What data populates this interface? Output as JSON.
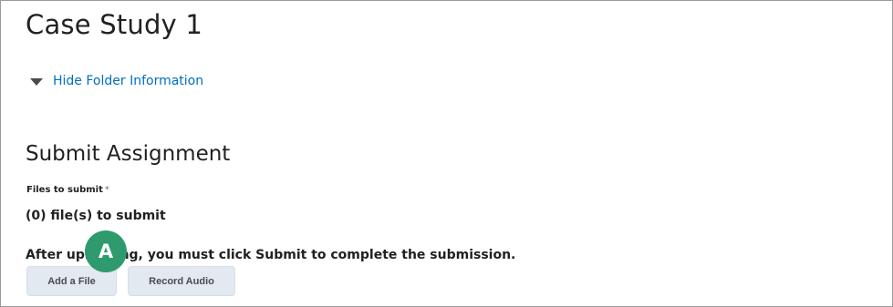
{
  "page": {
    "title": "Case Study 1"
  },
  "folder": {
    "toggle_label": "Hide Folder Information",
    "toggle_icon": "caret-down-icon"
  },
  "submit": {
    "section_title": "Submit Assignment",
    "files_label": "Files to submit",
    "required_marker": "*",
    "file_count_text": "(0) file(s) to submit",
    "instruction_text": "After uploading, you must click Submit to complete the submission.",
    "add_file_label": "Add a File",
    "record_audio_label": "Record Audio"
  },
  "callout": {
    "label": "A",
    "color": "#2e9a6e"
  },
  "colors": {
    "link": "#006fbf",
    "button_bg": "#e3e9f1",
    "text": "#202122"
  }
}
